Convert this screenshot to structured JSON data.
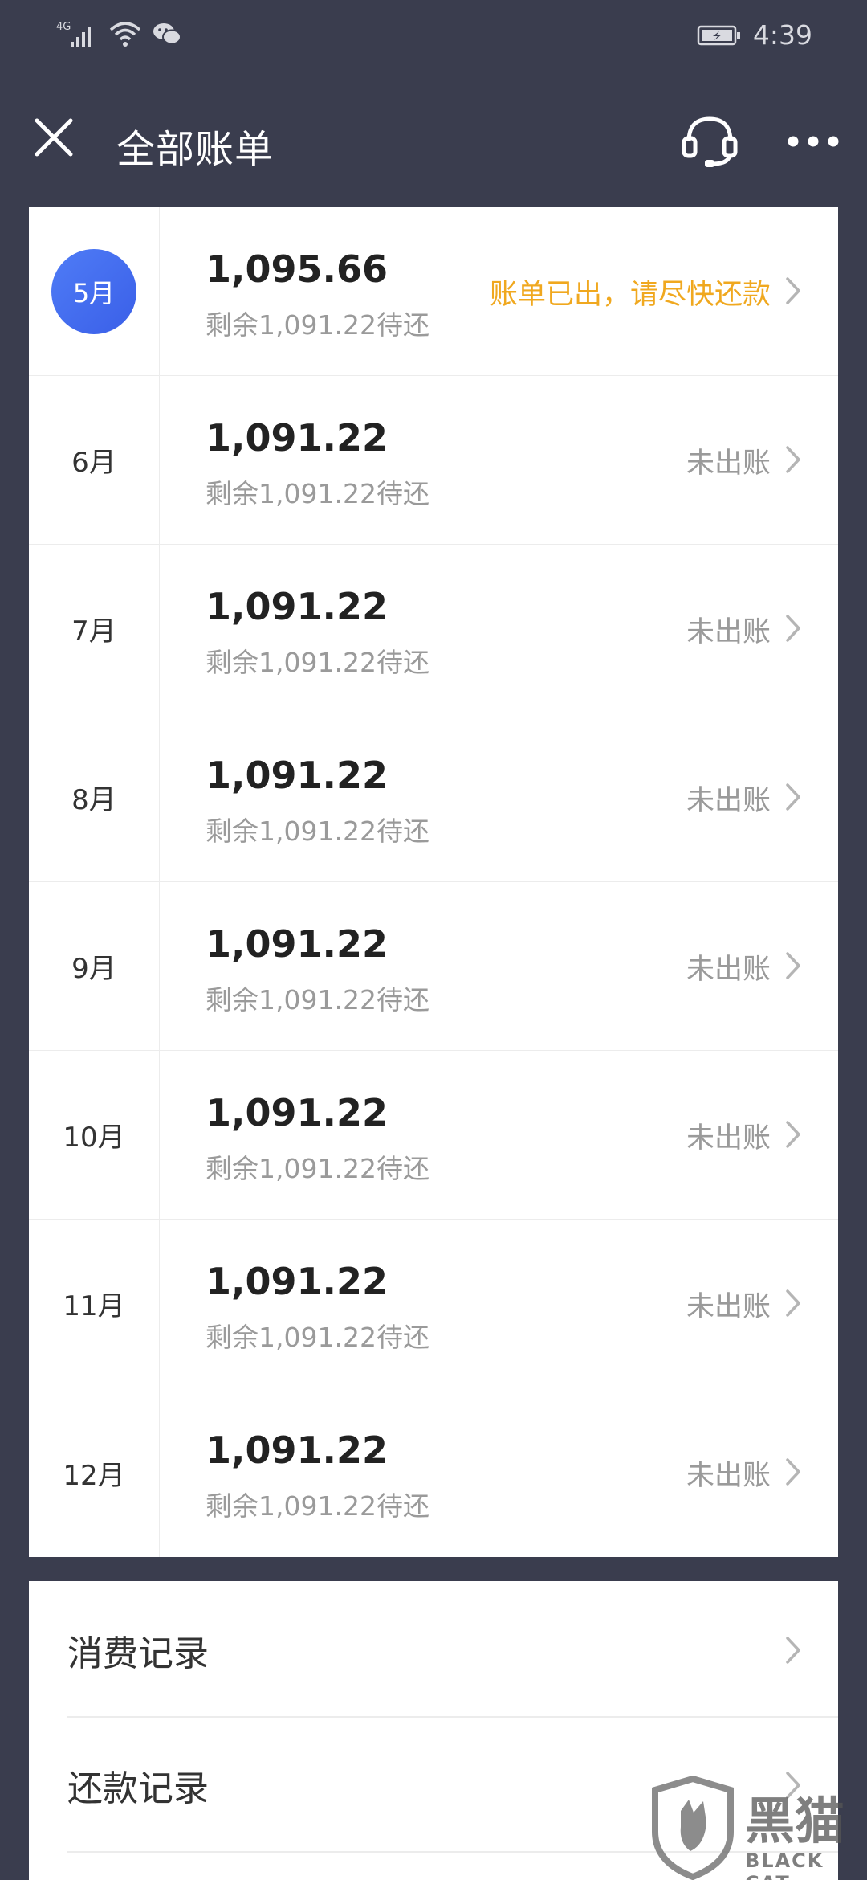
{
  "status_bar": {
    "network": "4G",
    "time": "4:39"
  },
  "header": {
    "title": "全部账单"
  },
  "bills": [
    {
      "month": "5月",
      "amount": "1,095.66",
      "remaining": "剩余1,091.22待还",
      "status": "账单已出，请尽快还款",
      "current": true
    },
    {
      "month": "6月",
      "amount": "1,091.22",
      "remaining": "剩余1,091.22待还",
      "status": "未出账",
      "current": false
    },
    {
      "month": "7月",
      "amount": "1,091.22",
      "remaining": "剩余1,091.22待还",
      "status": "未出账",
      "current": false
    },
    {
      "month": "8月",
      "amount": "1,091.22",
      "remaining": "剩余1,091.22待还",
      "status": "未出账",
      "current": false
    },
    {
      "month": "9月",
      "amount": "1,091.22",
      "remaining": "剩余1,091.22待还",
      "status": "未出账",
      "current": false
    },
    {
      "month": "10月",
      "amount": "1,091.22",
      "remaining": "剩余1,091.22待还",
      "status": "未出账",
      "current": false
    },
    {
      "month": "11月",
      "amount": "1,091.22",
      "remaining": "剩余1,091.22待还",
      "status": "未出账",
      "current": false
    },
    {
      "month": "12月",
      "amount": "1,091.22",
      "remaining": "剩余1,091.22待还",
      "status": "未出账",
      "current": false
    }
  ],
  "records": [
    {
      "label": "消费记录"
    },
    {
      "label": "还款记录"
    }
  ],
  "watermark": {
    "text": "黑猫",
    "sub": "BLACK CAT"
  },
  "colors": {
    "background": "#3a3d4e",
    "card": "#ffffff",
    "accent_badge": "#4f7cf6",
    "alert_status": "#f0a81f",
    "muted_text": "#9a9a9a"
  },
  "icons": [
    "signal-icon",
    "wifi-icon",
    "wechat-icon",
    "battery-icon",
    "close-icon",
    "headset-icon",
    "more-icon",
    "chevron-right-icon"
  ]
}
